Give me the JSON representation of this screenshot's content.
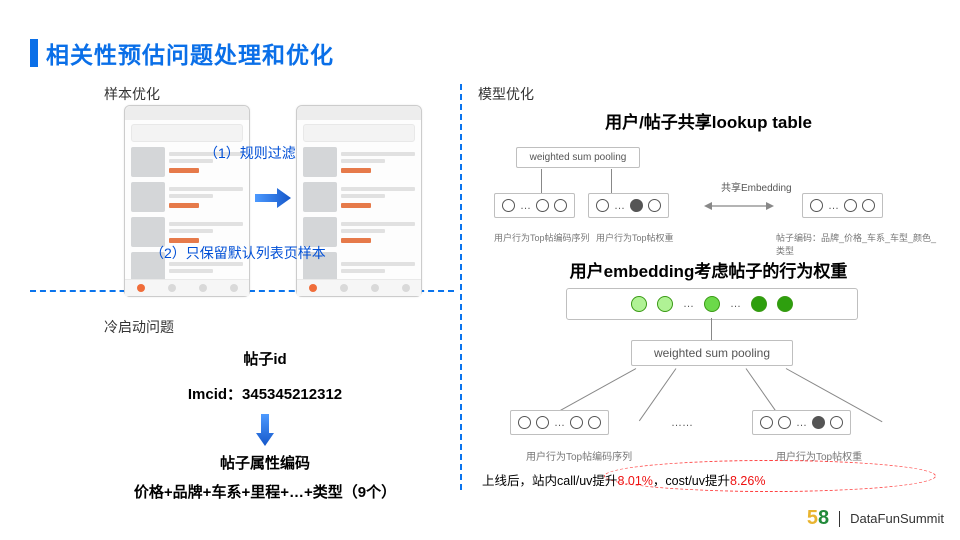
{
  "title": "相关性预估问题处理和优化",
  "sections": {
    "sample_opt": "样本优化",
    "cold_start": "冷启动问题",
    "model_opt": "模型优化"
  },
  "overlays": {
    "rule_filter": "（1）规则过滤",
    "keep_default": "（2）只保留默认列表页样本"
  },
  "cold": {
    "post_id_label": "帖子id",
    "imcid": "Imcid：345345212312",
    "encode_label": "帖子属性编码",
    "encode_detail": "价格+品牌+车系+里程+…+类型（9个）"
  },
  "model": {
    "lookup_title": "用户/帖子共享lookup table",
    "wsp": "weighted sum pooling",
    "share_emb": "共享Embedding",
    "cap_user_seq": "用户行为Top帖编码序列",
    "cap_user_wt": "用户行为Top帖权重",
    "cap_post_attr": "帖子编码：品牌_价格_车系_车型_颜色_类型",
    "emb_title": "用户embedding考虑帖子的行为权重"
  },
  "result": {
    "prefix": "上线后，站内call/uv提升",
    "v1": "8.01%",
    "mid": "，cost/uv提升",
    "v2": "8.26%"
  },
  "footer": {
    "brand5": "5",
    "brand8": "8",
    "conf": "DataFunSummit"
  }
}
